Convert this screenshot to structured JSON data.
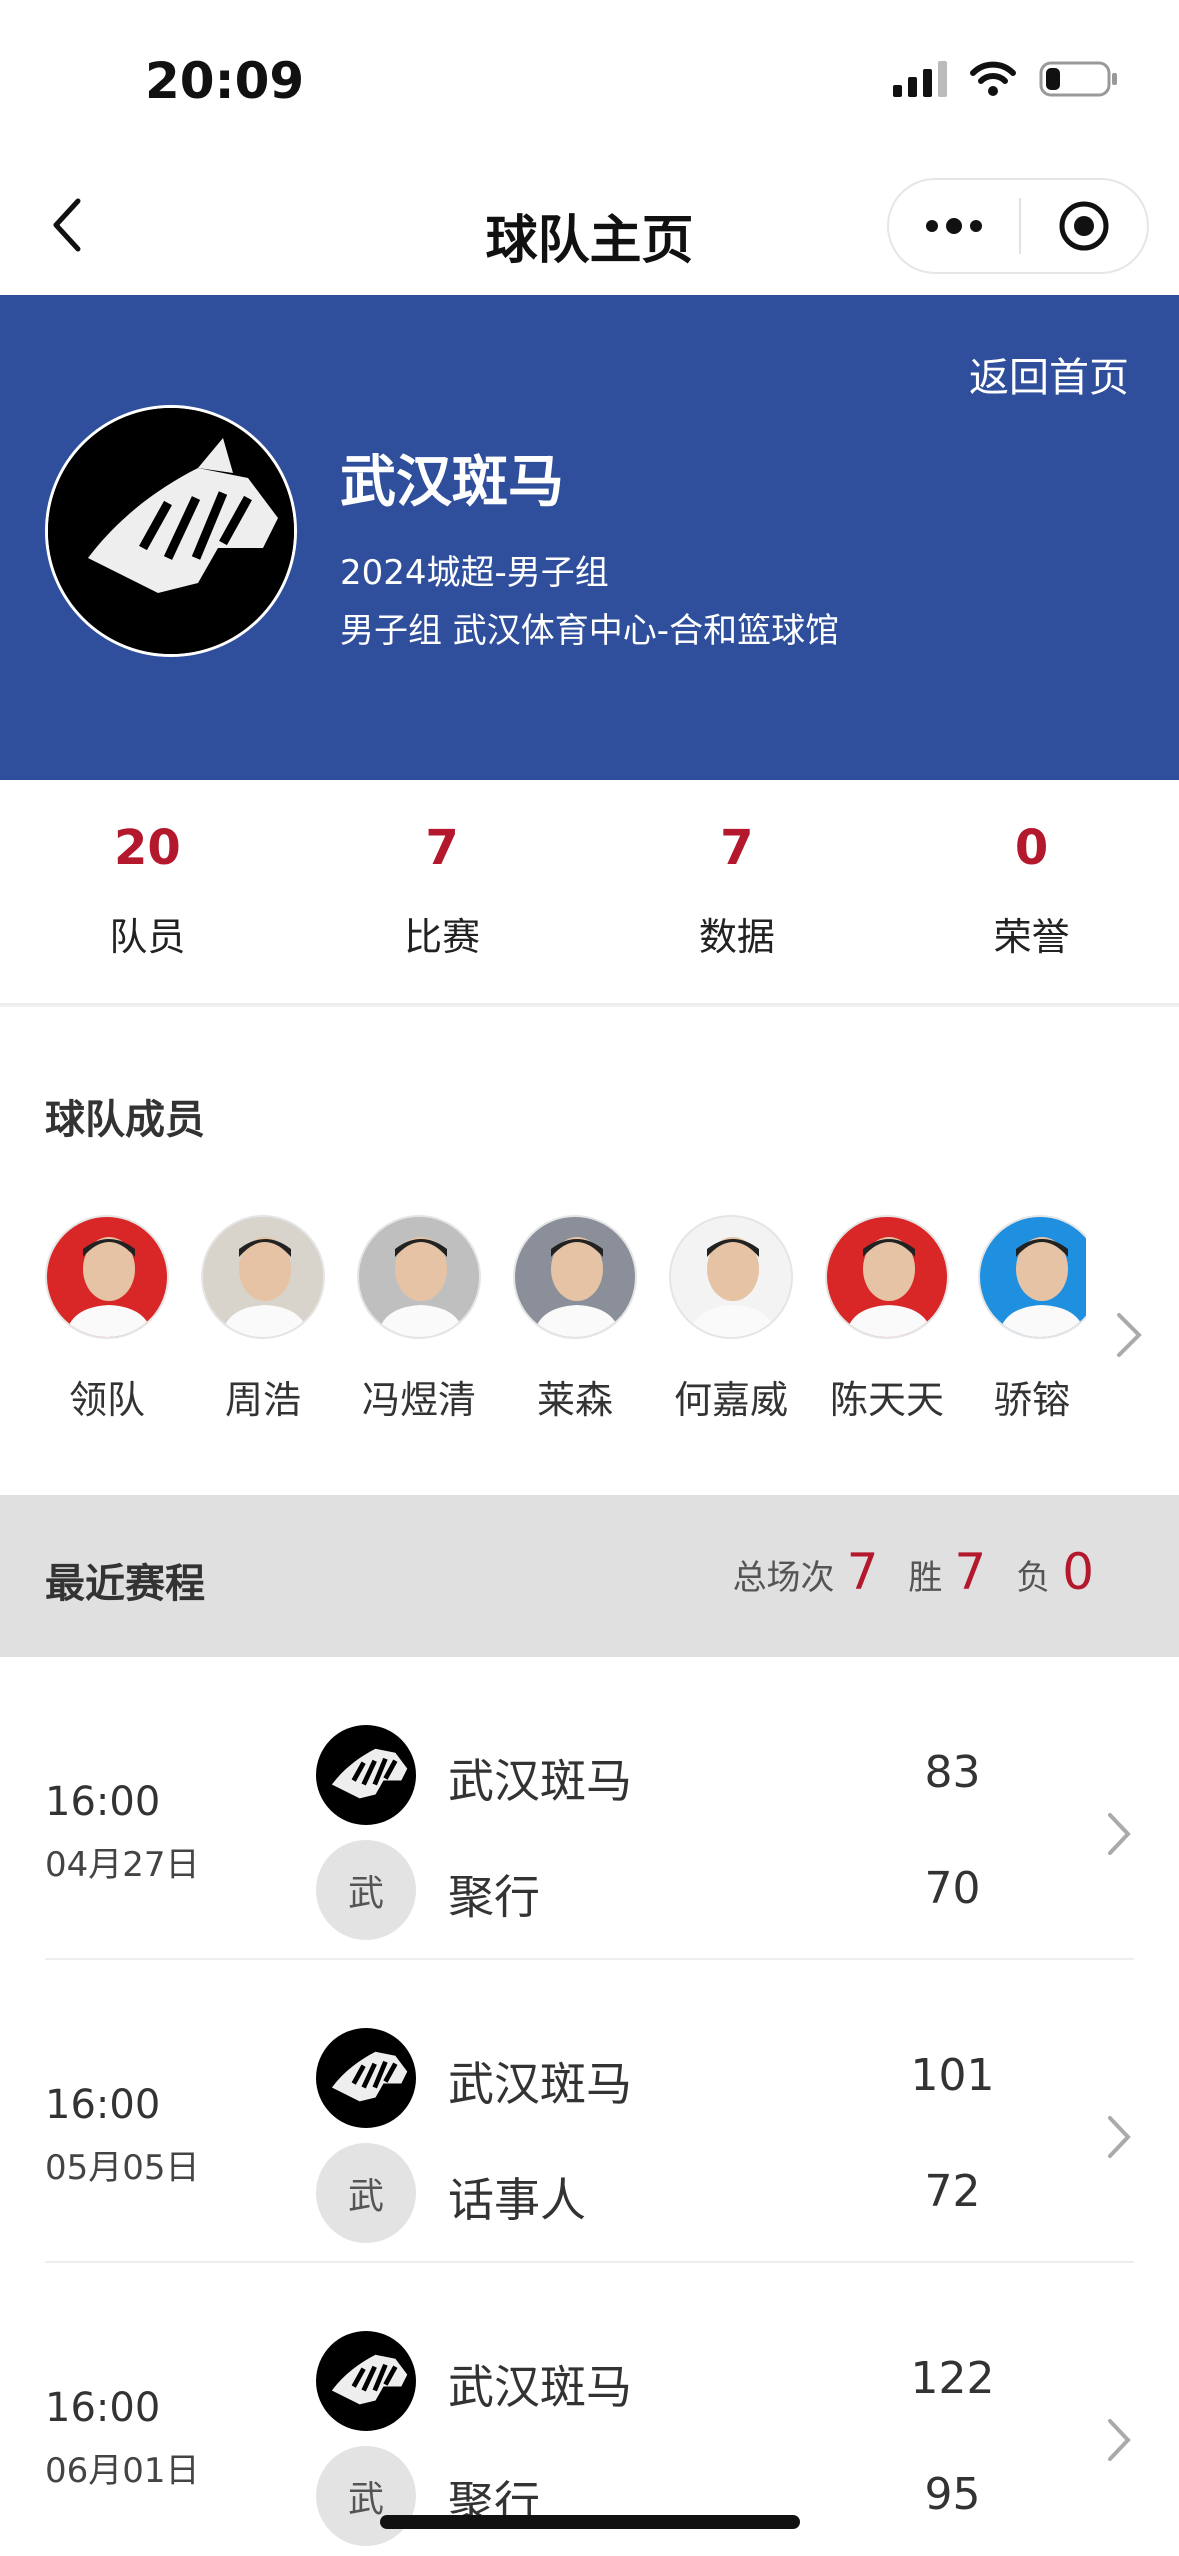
{
  "status_bar": {
    "time": "20:09"
  },
  "nav": {
    "title": "球队主页"
  },
  "team": {
    "back_home": "返回首页",
    "name": "武汉斑马",
    "league": "2024城超-男子组",
    "venue": "男子组 武汉体育中心-合和篮球馆"
  },
  "stats": [
    {
      "value": "20",
      "label": "队员"
    },
    {
      "value": "7",
      "label": "比赛"
    },
    {
      "value": "7",
      "label": "数据"
    },
    {
      "value": "0",
      "label": "荣誉"
    }
  ],
  "members": {
    "title": "球队成员",
    "items": [
      {
        "name": "领队",
        "bg": "#d92626"
      },
      {
        "name": "周浩",
        "bg": "#d8d4cc"
      },
      {
        "name": "冯煜清",
        "bg": "#bfbfbf"
      },
      {
        "name": "莱森",
        "bg": "#8a8f99"
      },
      {
        "name": "何嘉威",
        "bg": "#f3f3f3"
      },
      {
        "name": "陈天天",
        "bg": "#d92626"
      },
      {
        "name": "骄镕",
        "bg": "#1f8fe0"
      }
    ]
  },
  "schedule": {
    "title": "最近赛程",
    "total_label": "总场次",
    "total": "7",
    "win_label": "胜",
    "wins": "7",
    "loss_label": "负",
    "losses": "0"
  },
  "matches": [
    {
      "time": "16:00",
      "date": "04月27日",
      "home_team": "武汉斑马",
      "home_score": "83",
      "away_badge": "武",
      "away_team": "聚行",
      "away_score": "70"
    },
    {
      "time": "16:00",
      "date": "05月05日",
      "home_team": "武汉斑马",
      "home_score": "101",
      "away_badge": "武",
      "away_team": "话事人",
      "away_score": "72"
    },
    {
      "time": "16:00",
      "date": "06月01日",
      "home_team": "武汉斑马",
      "home_score": "122",
      "away_badge": "武",
      "away_team": "聚行",
      "away_score": "95"
    }
  ]
}
